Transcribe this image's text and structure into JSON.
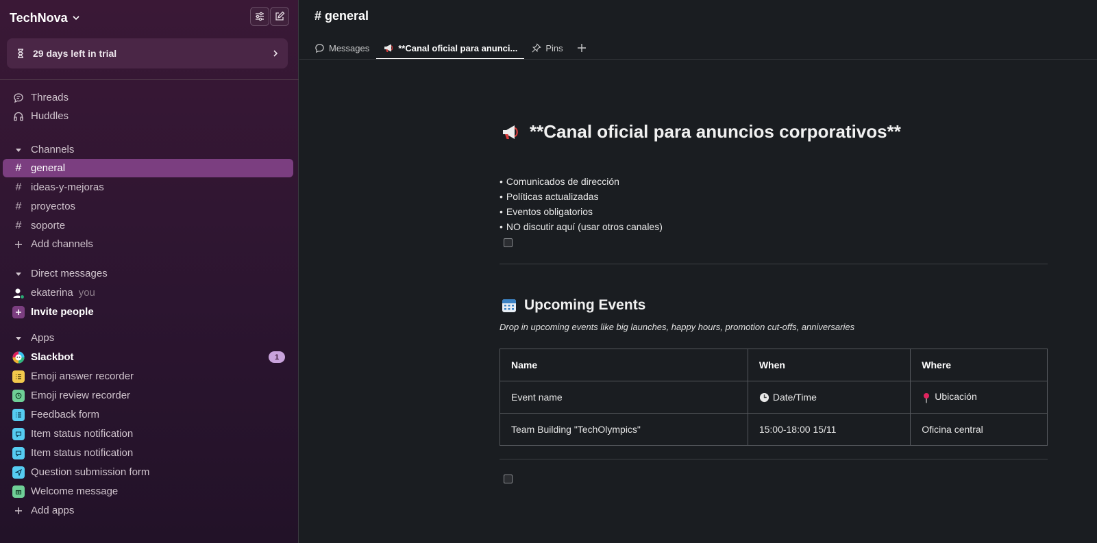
{
  "workspace": {
    "name": "TechNova"
  },
  "trial": {
    "label": "29 days left in trial"
  },
  "nav": {
    "threads": "Threads",
    "huddles": "Huddles"
  },
  "channels": {
    "section_label": "Channels",
    "items": [
      {
        "name": "general",
        "active": true
      },
      {
        "name": "ideas-y-mejoras"
      },
      {
        "name": "proyectos"
      },
      {
        "name": "soporte"
      }
    ],
    "add_label": "Add channels"
  },
  "direct_messages": {
    "section_label": "Direct messages",
    "user": "ekaterina",
    "you_label": "you",
    "invite_label": "Invite people"
  },
  "apps": {
    "section_label": "Apps",
    "items": [
      {
        "name": "Slackbot",
        "badge": "1"
      },
      {
        "name": "Emoji answer recorder",
        "color": "#f2c94c"
      },
      {
        "name": "Emoji review recorder",
        "color": "#6fcf97"
      },
      {
        "name": "Feedback form",
        "color": "#56ccf2"
      },
      {
        "name": "Item status notification",
        "color": "#56ccf2"
      },
      {
        "name": "Item status notification",
        "color": "#56ccf2"
      },
      {
        "name": "Question submission form",
        "color": "#56ccf2"
      },
      {
        "name": "Welcome message",
        "color": "#6fcf97"
      }
    ],
    "add_label": "Add apps"
  },
  "main": {
    "channel_title": "# general",
    "tabs": [
      {
        "label": "Messages",
        "icon": "chat-bubble-icon"
      },
      {
        "label": "**Canal oficial para anunci...",
        "icon": "megaphone-icon",
        "active": true
      },
      {
        "label": "Pins",
        "icon": "pin-icon"
      }
    ],
    "canvas": {
      "heading": "**Canal oficial para anuncios corporativos**",
      "bullets": [
        "Comunicados de dirección",
        "Políticas actualizadas",
        "Eventos obligatorios",
        "NO discutir aquí (usar otros canales)"
      ],
      "events_heading": "Upcoming Events",
      "events_subtitle": "Drop in upcoming events like big launches, happy hours, promotion cut-offs, anniversaries",
      "table": {
        "headers": [
          "Name",
          "When",
          "Where"
        ],
        "rows": [
          [
            "Event name",
            "Date/Time",
            "Ubicación"
          ],
          [
            "Team Building \"TechOlympics\"",
            "15:00-18:00 15/11",
            "Oficina central"
          ]
        ]
      }
    }
  }
}
